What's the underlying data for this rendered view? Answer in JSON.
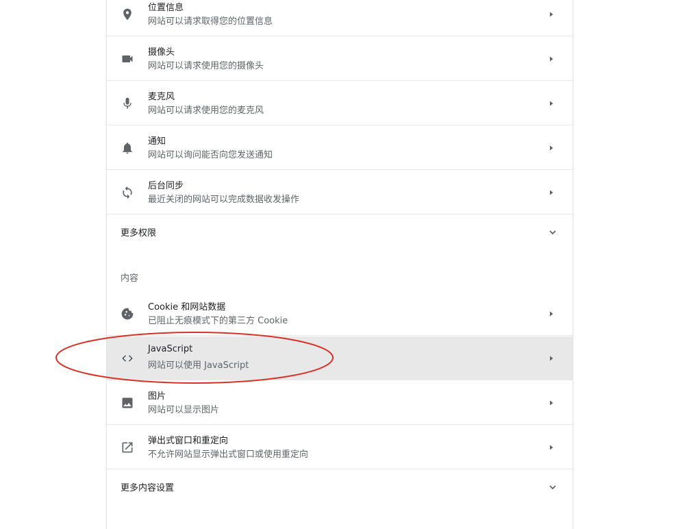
{
  "permissions": [
    {
      "title": "位置信息",
      "subtitle": "网站可以请求取得您的位置信息",
      "icon": "location-pin-icon"
    },
    {
      "title": "摄像头",
      "subtitle": "网站可以请求使用您的摄像头",
      "icon": "camera-icon"
    },
    {
      "title": "麦克风",
      "subtitle": "网站可以请求使用您的麦克风",
      "icon": "microphone-icon"
    },
    {
      "title": "通知",
      "subtitle": "网站可以询问能否向您发送通知",
      "icon": "bell-icon"
    },
    {
      "title": "后台同步",
      "subtitle": "最近关闭的网站可以完成数据收发操作",
      "icon": "sync-icon"
    }
  ],
  "more_permissions": {
    "label": "更多权限"
  },
  "content_section": {
    "title": "内容"
  },
  "content": [
    {
      "title": "Cookie 和网站数据",
      "subtitle": "已阻止无痕模式下的第三方 Cookie",
      "icon": "cookie-icon"
    },
    {
      "title": "JavaScript",
      "subtitle": "网站可以使用 JavaScript",
      "icon": "code-icon"
    },
    {
      "title": "图片",
      "subtitle": "网站可以显示图片",
      "icon": "image-icon"
    },
    {
      "title": "弹出式窗口和重定向",
      "subtitle": "不允许网站显示弹出式窗口或使用重定向",
      "icon": "open-in-new-icon"
    }
  ],
  "more_content": {
    "label": "更多内容设置"
  },
  "colors": {
    "highlight_row": "#e8e8e9",
    "annotation_ellipse": "#d93025",
    "icon": "#5f6368"
  }
}
